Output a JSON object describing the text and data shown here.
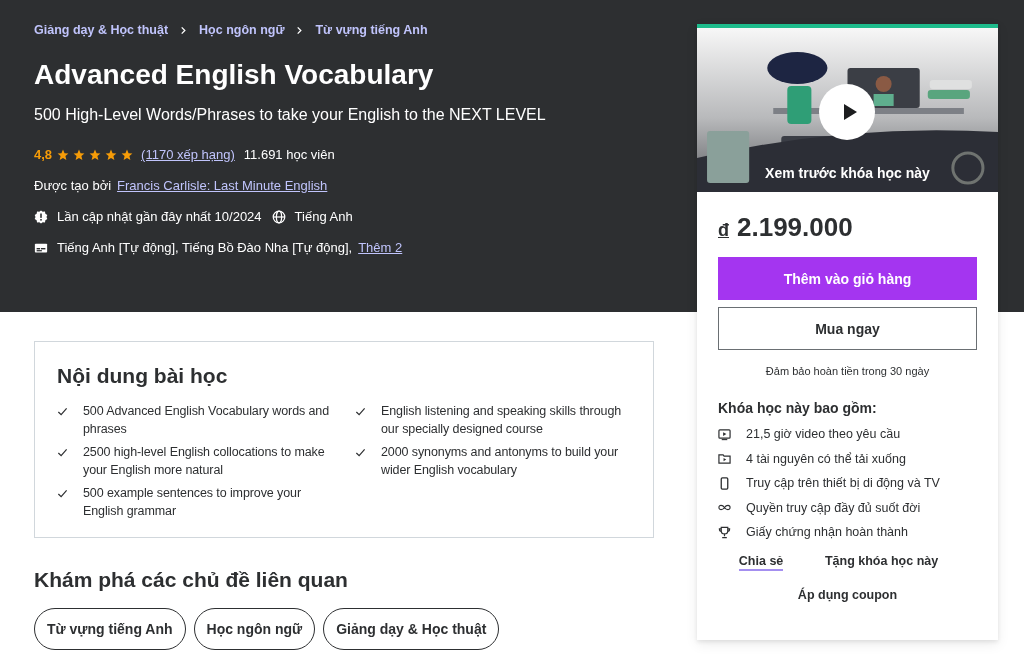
{
  "breadcrumb": [
    "Giảng dạy & Học thuật",
    "Học ngôn ngữ",
    "Từ vựng tiếng Anh"
  ],
  "title": "Advanced English Vocabulary",
  "subtitle": "500 High-Level Words/Phrases to take your English to the NEXT LEVEL",
  "rating": {
    "score": "4,8",
    "stars": 5,
    "count": "(1170 xếp hạng)",
    "students": "11.691 học viên"
  },
  "created_by": {
    "label": "Được tạo bởi",
    "author": "Francis Carlisle: Last Minute English"
  },
  "updated": "Lần cập nhật gần đây nhất 10/2024",
  "language": "Tiếng Anh",
  "captions": {
    "text": "Tiếng Anh [Tự động], Tiếng Bồ Đào Nha [Tự động],",
    "more": "Thêm 2"
  },
  "learn": {
    "heading": "Nội dung bài học",
    "items": [
      {
        "text": "500 Advanced English Vocabulary words and phrases"
      },
      {
        "text": "English listening and speaking skills through our specially designed course"
      },
      {
        "text": "2500 high-level English collocations to make your English more natural"
      },
      {
        "text": "2000 synonyms and antonyms to build your wider English vocabulary"
      },
      {
        "text": "500 example sentences to improve your English grammar"
      }
    ]
  },
  "related": {
    "heading": "Khám phá các chủ đề liên quan",
    "topics": [
      "Từ vựng tiếng Anh",
      "Học ngôn ngữ",
      "Giảng dạy & Học thuật"
    ]
  },
  "sidebar": {
    "preview": {
      "kind": "picture",
      "caption": "Xem trước khóa học này"
    },
    "currency": "đ",
    "price": "2.199.000",
    "add_to_cart": "Thêm vào giỏ hàng",
    "buy_now": "Mua ngay",
    "guarantee": "Đảm bảo hoàn tiền trong 30 ngày",
    "includes_heading": "Khóa học này bao gồm:",
    "includes": [
      {
        "kind": "video",
        "text": "21,5 giờ video theo yêu cầu"
      },
      {
        "kind": "download",
        "text": "4 tài nguyên có thể tải xuống"
      },
      {
        "kind": "mobile",
        "text": "Truy cập trên thiết bị di động và TV"
      },
      {
        "kind": "lifetime",
        "text": "Quyền truy cập đầy đủ suốt đời"
      },
      {
        "kind": "certificate",
        "text": "Giấy chứng nhận hoàn thành"
      }
    ],
    "share": "Chia sẻ",
    "gift": "Tặng khóa học này",
    "coupon": "Áp dụng coupon"
  }
}
